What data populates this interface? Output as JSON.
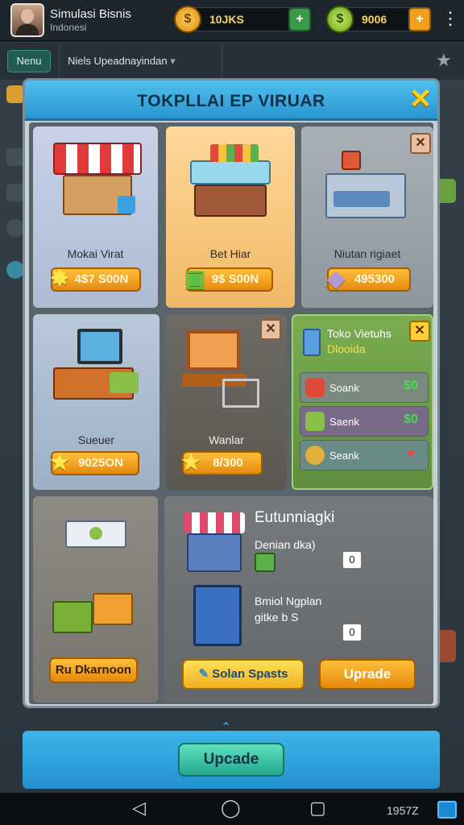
{
  "header": {
    "player_name": "Simulasi Bisnis",
    "player_sub": "Indonesi",
    "currency1": {
      "value": "10JKS",
      "icon": "coin-icon",
      "plus": "+"
    },
    "currency2": {
      "value": "9006",
      "icon": "gem-icon",
      "plus": "+"
    },
    "menu": "⋮"
  },
  "subbar": {
    "menu_label": "Nenu",
    "dropdown_label": "Niels Upeadnayindan",
    "dropdown_arrow": "▾"
  },
  "modal": {
    "title": "TOKPLLAI EP VIRUAR",
    "close": "✕",
    "cards": [
      {
        "name": "Mokai Virat",
        "price": "4$7 S00N"
      },
      {
        "name": "Bet Hiar",
        "price": "9$ S00N"
      },
      {
        "name": "Niutan rigiaet",
        "price": "495300"
      },
      {
        "name": "Sueuer",
        "price": "9025ON"
      },
      {
        "name": "Wanlar",
        "price": "8/300"
      }
    ],
    "toko_panel": {
      "title": "Toko Vietuhs",
      "subtitle": "Dlooida",
      "rows": [
        {
          "label": "Soank",
          "value": "$0"
        },
        {
          "label": "Saenk",
          "value": "$0"
        },
        {
          "label": "Seank",
          "value": "●"
        }
      ]
    },
    "left_bottom_button": "Ru Dkarnoon",
    "upgrade_panel": {
      "title": "Eutunniagki",
      "item1_label": "Denian dka)",
      "item1_value": "0",
      "item2_label1": "Bmiol Ngplan",
      "item2_label2": "gitke b S",
      "item2_value": "0",
      "btn_left": "Solan Spasts",
      "btn_right": "Uprade"
    }
  },
  "bottom": {
    "upgrade_label": "Upcade",
    "chevron": "⌃"
  },
  "navbar": {
    "back": "◁",
    "home": "◯",
    "recent": "▢",
    "time": "1957Z"
  },
  "colors": {
    "accent_blue": "#2a95cf",
    "gold": "#ffcf3a",
    "orange": "#e48a0e",
    "green_panel": "#6c9a48"
  }
}
